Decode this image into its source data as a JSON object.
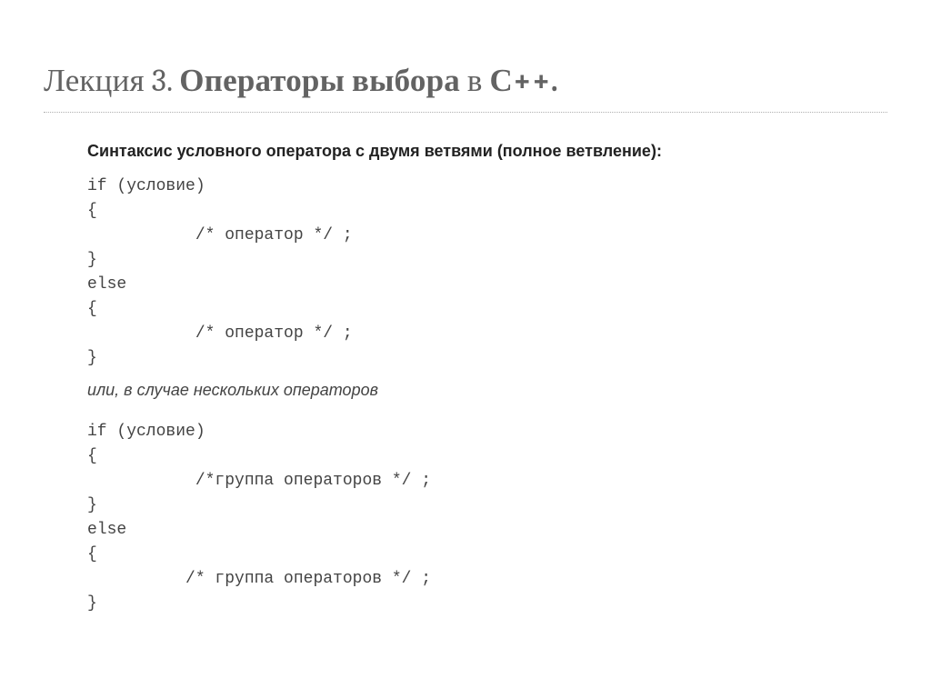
{
  "title": {
    "prefix": "Лекция 3. ",
    "bold1": "Операторы выбора",
    "mid": " в ",
    "bold2": "С++."
  },
  "subtitle": "Синтаксис условного оператора с двумя ветвями (полное ветвление):",
  "code1": "if (условие)\n{\n           /* оператор */ ;\n}\nelse\n{\n           /* оператор */ ;\n}",
  "note": "или, в случае нескольких операторов",
  "code2": "if (условие)\n{\n           /*группа операторов */ ;\n}\nelse\n{\n          /* группа операторов */ ;\n}"
}
